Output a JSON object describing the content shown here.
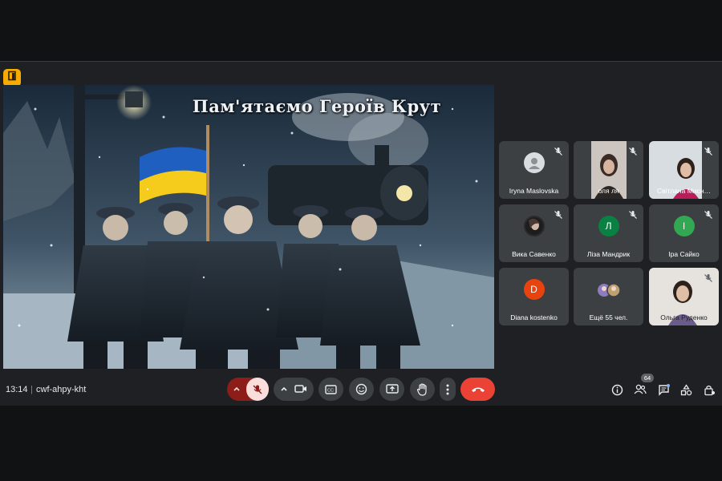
{
  "meeting": {
    "time": "13:14",
    "separator": "|",
    "code": "cwf-ahpy-kht",
    "participants_count": "64"
  },
  "presentation": {
    "title": "Пам'ятаємо Героїв Крут"
  },
  "participants": [
    {
      "name": "Iryna Maslovska",
      "avatar": "photo"
    },
    {
      "name": "оля ля",
      "avatar": "video"
    },
    {
      "name": "Світлана Мисн…",
      "avatar": "video"
    },
    {
      "name": "Вика Савенко",
      "avatar": "photo"
    },
    {
      "name": "Ліза Мандрик",
      "avatar": "Л",
      "color": "#0b8043"
    },
    {
      "name": "Іра Сайко",
      "avatar": "І",
      "color": "#33a852"
    },
    {
      "name": "Diana kostenko",
      "avatar": "D",
      "color": "#e8430e"
    },
    {
      "name": "Ещё 55 чел.",
      "avatar": "group"
    },
    {
      "name": "Ольга Руденко",
      "avatar": "video"
    }
  ],
  "colors": {
    "end_call": "#ea4335",
    "mic_off_bg": "#f9dedc",
    "mic_arrow_bg": "#8c1d18",
    "tile_bg": "#3c4043",
    "badge": "#f9ab00"
  }
}
